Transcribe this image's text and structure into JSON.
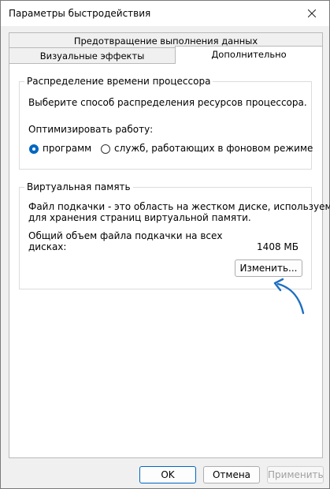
{
  "window": {
    "title": "Параметры быстродействия"
  },
  "tabs": {
    "data_execution": "Предотвращение выполнения данных",
    "visual_effects": "Визуальные эффекты",
    "advanced": "Дополнительно"
  },
  "cpu": {
    "legend": "Распределение времени процессора",
    "description": "Выберите способ распределения ресурсов процессора.",
    "optimize_label": "Оптимизировать работу:",
    "options": [
      {
        "label": "программ",
        "checked": true
      },
      {
        "label": "служб, работающих в фоновом режиме",
        "checked": false
      }
    ]
  },
  "virtual_memory": {
    "legend": "Виртуальная память",
    "description_line1": "Файл подкачки - это область на жестком диске, используемая",
    "description_line2": "для хранения страниц виртуальной памяти.",
    "total_label_line1": "Общий объем файла подкачки на всех",
    "total_label_line2": "дисках:",
    "total_value": "1408 МБ",
    "change_button": "Изменить..."
  },
  "buttons": {
    "ok": "OK",
    "cancel": "Отмена",
    "apply": "Применить"
  },
  "colors": {
    "accent": "#0067c0",
    "annotation_arrow": "#1e6fc1"
  }
}
